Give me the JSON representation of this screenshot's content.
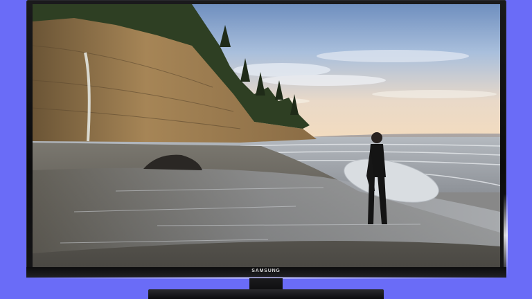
{
  "tv": {
    "brand_label": "SAMSUNG"
  },
  "scene": {
    "subject": "surfer-with-surfboard",
    "colors": {
      "background": "#6a6cf7",
      "bezel": "#0e0e10",
      "sky_top": "#7f9fc9",
      "sky_horizon": "#f3dcc0",
      "sea": "#9aa0a6",
      "beach": "#6d6a63"
    }
  }
}
